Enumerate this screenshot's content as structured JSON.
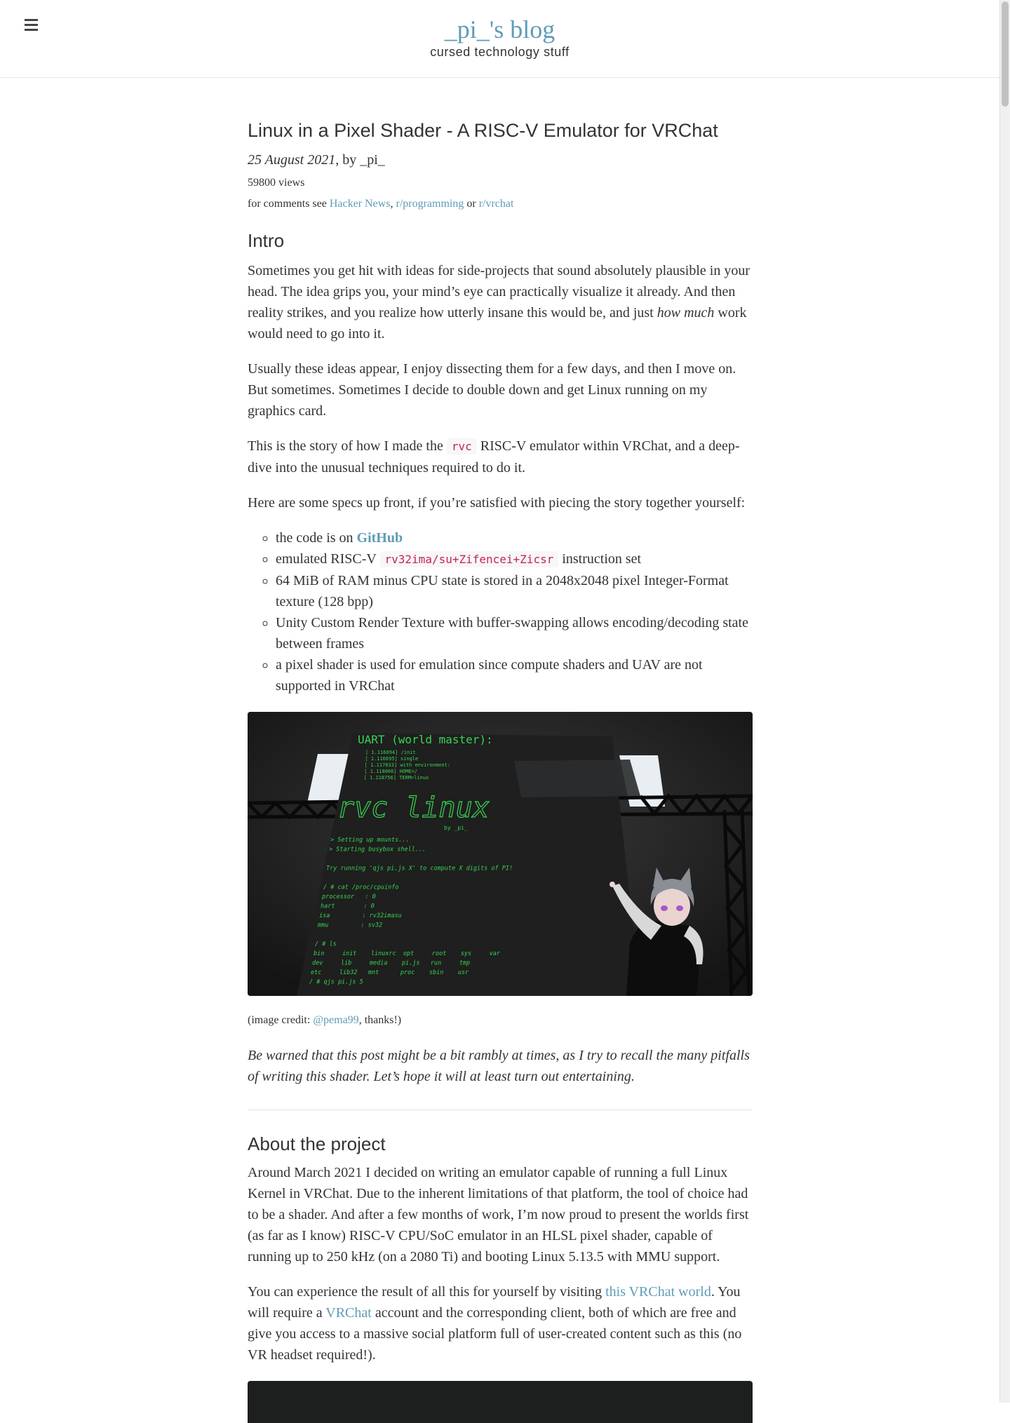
{
  "header": {
    "site_title": "_pi_'s blog",
    "subtitle": "cursed technology stuff",
    "menu_icon": "hamburger-menu-icon"
  },
  "post": {
    "title": "Linux in a Pixel Shader - A RISC-V Emulator for VRChat",
    "date": "25 August 2021",
    "byline": ", by _pi_",
    "views": "59800 views",
    "comments_prefix": "for comments see ",
    "comments_links": [
      "Hacker News",
      "r/programming",
      "r/vrchat"
    ],
    "comments_sep1": ", ",
    "comments_sep2": " or "
  },
  "intro": {
    "heading": "Intro",
    "p1_a": "Sometimes you get hit with ideas for side-projects that sound absolutely plausible in your head. The idea grips you, your mind’s eye can practically visualize it already. And then reality strikes, and you realize how utterly insane this would be, and just ",
    "p1_em": "how much",
    "p1_b": " work would need to go into it.",
    "p2": "Usually these ideas appear, I enjoy dissecting them for a few days, and then I move on. But sometimes. Sometimes I decide to double down and get Linux running on my graphics card.",
    "p3_a": "This is the story of how I made the ",
    "p3_code": "rvc",
    "p3_b": " RISC-V emulator within VRChat, and a deep-dive into the unusual techniques required to do it.",
    "p4": "Here are some specs up front, if you’re satisfied with piecing the story together yourself:",
    "specs": {
      "s1_a": "the code is on ",
      "s1_link": "GitHub",
      "s2_a": "emulated RISC-V ",
      "s2_code": "rv32ima/su+Zifencei+Zicsr",
      "s2_b": " instruction set",
      "s3": "64 MiB of RAM minus CPU state is stored in a 2048x2048 pixel Integer-Format texture (128 bpp)",
      "s4": "Unity Custom Render Texture with buffer-swapping allows encoding/decoding state between frames",
      "s5": "a pixel shader is used for emulation since compute shaders and UAV are not supported in VRChat"
    },
    "figure": {
      "uart_title": "UART (world master):",
      "boot_lines": [
        "[  1.116094]    /init",
        "[  1.116695]    single",
        "[  1.117033]    with environment:",
        "[  1.118066]    HOME=/",
        "[  1.118756]    TERM=linux"
      ],
      "logo": "rvc linux",
      "logo_by": "by _pi_",
      "shell_lines": [
        "> Setting up mounts...",
        "> Starting busybox shell...",
        "",
        "Try running 'qjs pi.js X' to compute X digits of PI!",
        "",
        "/ # cat /proc/cpuinfo",
        "processor   : 0",
        "hart        : 0",
        "isa         : rv32imasu",
        "mmu         : sv32",
        "",
        "/ # ls",
        "bin     init    linuxrc  opt     root    sys     var",
        "dev     lib     media    pi.js   run     tmp",
        "etc     lib32   mnt      proc    sbin    usr",
        "/ # qjs pi.js 5"
      ]
    },
    "caption_a": "(image credit: ",
    "caption_link": "@pema99",
    "caption_b": ", thanks!)",
    "warning": "Be warned that this post might be a bit rambly at times, as I try to recall the many pitfalls of writing this shader. Let’s hope it will at least turn out entertaining."
  },
  "about": {
    "heading": "About the project",
    "p1": "Around March 2021 I decided on writing an emulator capable of running a full Linux Kernel in VRChat. Due to the inherent limitations of that platform, the tool of choice had to be a shader. And after a few months of work, I’m now proud to present the worlds first (as far as I know) RISC-V CPU/SoC emulator in an HLSL pixel shader, capable of running up to 250 kHz (on a 2080 Ti) and booting Linux 5.13.5 with MMU support.",
    "p2_a": "You can experience the result of all this for yourself by visiting ",
    "p2_link1": "this VRChat world",
    "p2_b": ". You will require a ",
    "p2_link2": "VRChat",
    "p2_c": " account and the corresponding client, both of which are free and give you access to a massive social platform full of user-created content such as this (no VR headset required!)."
  },
  "colors": {
    "link": "#5f9cb8",
    "code_text": "#c7254e",
    "terminal_green": "#39d353"
  }
}
